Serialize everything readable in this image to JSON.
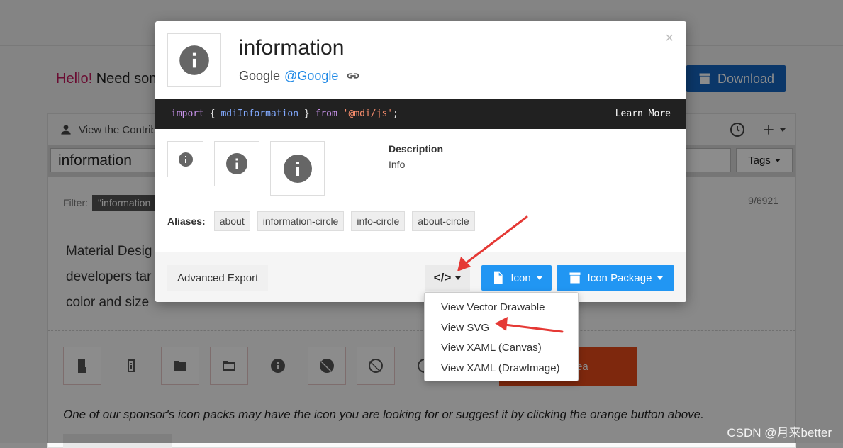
{
  "background": {
    "hello_red": "Hello!",
    "hello_rest": " Need som",
    "download_label": "Download",
    "contrib_label": "View the Contrib",
    "search_value": "information",
    "tags_label": "Tags",
    "filter_label": "Filter:",
    "filter_chip": "\"information",
    "count": "9/6921",
    "md_lines": [
      "Material Desig",
      "developers tar",
      "color and size"
    ],
    "idea_label": "con Idea",
    "sponsor_text": "One of our sponsor's icon packs may have the icon you are looking for or suggest it by clicking the orange button above."
  },
  "modal": {
    "title": "information",
    "author_name": "Google",
    "author_link": "@Google",
    "code": {
      "kw_import": "import",
      "brace_open": "{",
      "name": "mdiInformation",
      "brace_close": "}",
      "kw_from": "from",
      "module": "'@mdi/js'",
      "semicolon": ";"
    },
    "learn_more": "Learn More",
    "description_heading": "Description",
    "description_value": "Info",
    "aliases_label": "Aliases:",
    "aliases": [
      "about",
      "information-circle",
      "info-circle",
      "about-circle"
    ],
    "advanced_export": "Advanced Export",
    "code_button_glyph": "</>",
    "icon_button": "Icon",
    "icon_package_button": "Icon Package"
  },
  "dropdown": {
    "items": [
      "View Vector Drawable",
      "View SVG",
      "View XAML (Canvas)",
      "View XAML (DrawImage)"
    ]
  },
  "watermark": "CSDN @月来better",
  "colors": {
    "annotation_arrow": "#e53935",
    "primary_button": "#2196f3",
    "code_bar": "#212121"
  }
}
